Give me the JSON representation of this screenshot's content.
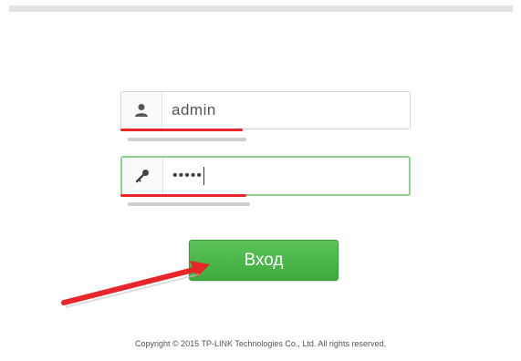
{
  "login_form": {
    "username_value": "admin",
    "password_value": "•••••",
    "login_button_label": "Вход"
  },
  "footer": {
    "copyright": "Copyright © 2015 TP-LINK Technologies Co., Ltd. All rights reserved."
  },
  "colors": {
    "accent_green": "#4cb84a",
    "annotation_red": "#e8262a",
    "focus_border": "#8fd28c"
  },
  "icons": {
    "username": "user-icon",
    "password": "key-icon",
    "annotation": "arrow-icon"
  }
}
